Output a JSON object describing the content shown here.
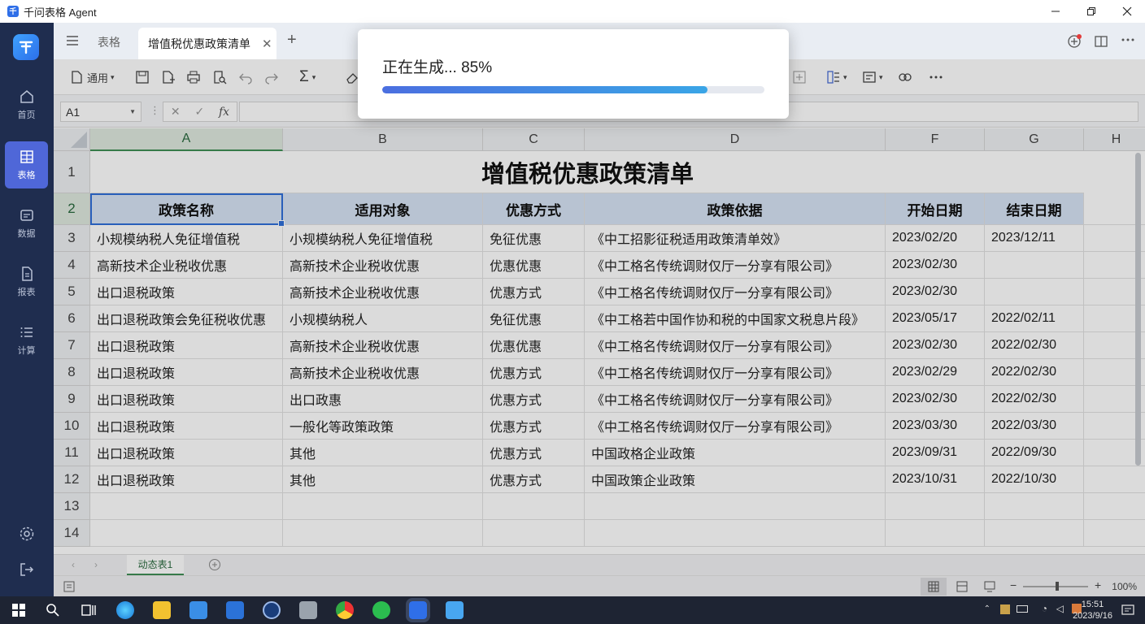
{
  "app": {
    "title": "千问表格 Agent"
  },
  "sidebar": {
    "items": [
      {
        "label": "首页"
      },
      {
        "label": "表格"
      },
      {
        "label": "数据"
      },
      {
        "label": "报表"
      },
      {
        "label": "计算"
      }
    ]
  },
  "tabs": {
    "other": "表格",
    "active": "增值税优惠政策清单"
  },
  "toolbar": {
    "first_label": "通用"
  },
  "formula": {
    "cell_ref": "A1",
    "fx": "fx",
    "value": ""
  },
  "dialog": {
    "message": "正在生成... 85%",
    "progress": 0.85
  },
  "columns": [
    "A",
    "B",
    "C",
    "D",
    "F",
    "G",
    "H"
  ],
  "rows_numbers": [
    "1",
    "2",
    "3",
    "4",
    "5",
    "6",
    "7",
    "8",
    "9",
    "10",
    "11",
    "12",
    "13",
    "14"
  ],
  "sheet": {
    "title": "增值税优惠政策清单",
    "headers": [
      "政策名称",
      "适用对象",
      "优惠方式",
      "政策依据",
      "开始日期",
      "结束日期"
    ],
    "rows": [
      [
        "小规模纳税人免征增值税",
        "小规模纳税人免征增值税",
        "免征优惠",
        "《中工招影征税适用政策清单效》",
        "2023/02/20",
        "2023/12/11"
      ],
      [
        "高新技术企业税收优惠",
        "高新技术企业税收优惠",
        "优惠优惠",
        "《中工格名传统调财仅厅一分享有限公司》",
        "2023/02/30",
        ""
      ],
      [
        "出口退税政策",
        "高新技术企业税收优惠",
        "优惠方式",
        "《中工格名传统调财仅厅一分享有限公司》",
        "2023/02/30",
        ""
      ],
      [
        "出口退税政策会免征税收优惠",
        "小规模纳税人",
        "免征优惠",
        "《中工格若中国作协和税的中国家文税息片段》",
        "2023/05/17",
        "2022/02/11"
      ],
      [
        "出口退税政策",
        "高新技术企业税收优惠",
        "优惠优惠",
        "《中工格名传统调财仅厅一分享有限公司》",
        "2023/02/30",
        "2022/02/30"
      ],
      [
        "出口退税政策",
        "高新技术企业税收优惠",
        "优惠方式",
        "《中工格名传统调财仅厅一分享有限公司》",
        "2023/02/29",
        "2022/02/30"
      ],
      [
        "出口退税政策",
        "出口政惠",
        "优惠方式",
        "《中工格名传统调财仅厅一分享有限公司》",
        "2023/02/30",
        "2022/02/30"
      ],
      [
        "出口退税政策",
        "一般化等政策政策",
        "优惠方式",
        "《中工格名传统调财仅厅一分享有限公司》",
        "2023/03/30",
        "2022/03/30"
      ],
      [
        "出口退税政策",
        "其他",
        "优惠方式",
        "中国政格企业政策",
        "2023/09/31",
        "2022/09/30"
      ],
      [
        "出口退税政策",
        "其他",
        "优惠方式",
        "中国政策企业政策",
        "2023/10/31",
        "2022/10/30"
      ]
    ]
  },
  "sheet_tab": "动态表1",
  "zoom": "100%",
  "clock": {
    "time": "15:51",
    "date": "2023/9/16"
  }
}
